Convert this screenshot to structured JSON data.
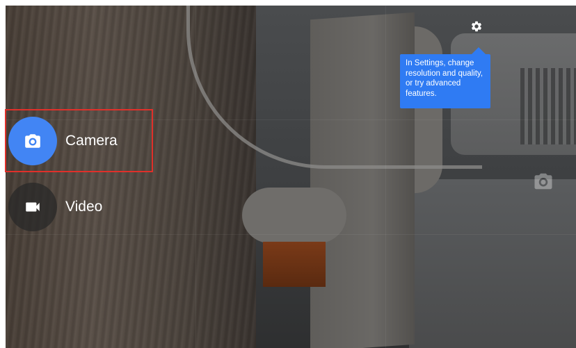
{
  "modes": [
    {
      "label": "Camera",
      "icon": "camera-icon",
      "active": true
    },
    {
      "label": "Video",
      "icon": "video-icon",
      "active": false
    }
  ],
  "settings": {
    "icon": "gear-icon",
    "tooltip": "In Settings, change resolution and quality, or try advanced features."
  },
  "colors": {
    "accent": "#4285f4",
    "tooltip_bg": "#2f7bf3",
    "highlight": "#e0302a"
  }
}
